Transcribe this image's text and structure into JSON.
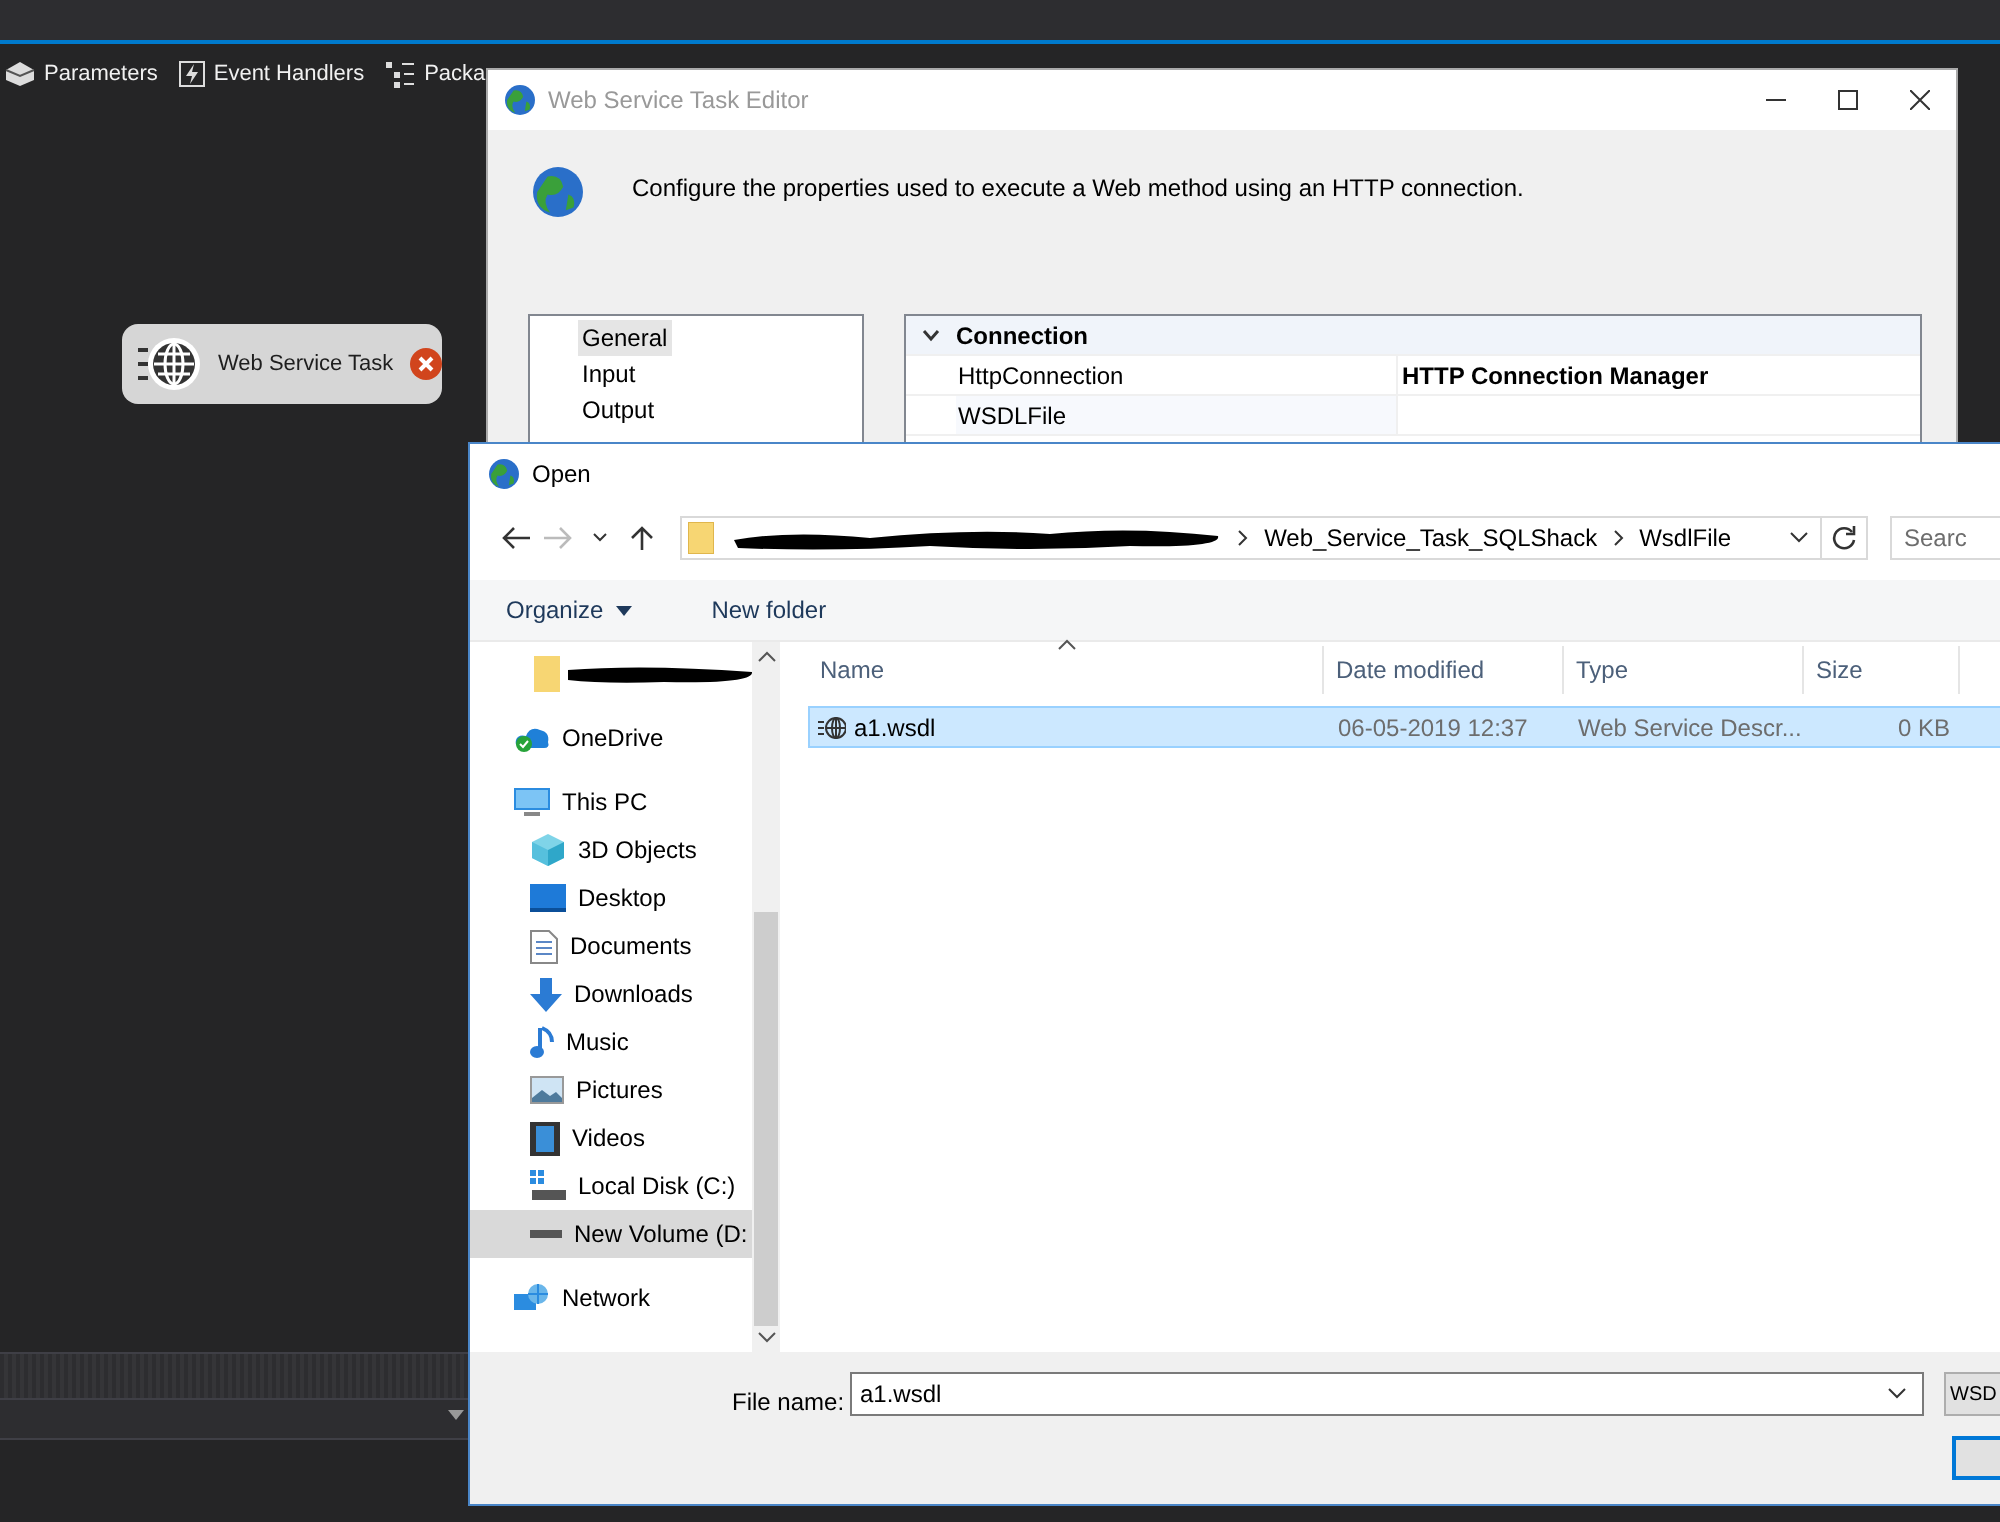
{
  "ide": {
    "toolbar_tabs": [
      {
        "label": "Parameters"
      },
      {
        "label": "Event Handlers"
      },
      {
        "label": "Packa"
      }
    ],
    "task_node": {
      "label": "Web Service Task",
      "error": true
    }
  },
  "editor": {
    "title": "Web Service Task Editor",
    "description": "Configure the properties used to execute a Web method using an HTTP connection.",
    "pages": [
      {
        "label": "General",
        "selected": true
      },
      {
        "label": "Input",
        "selected": false
      },
      {
        "label": "Output",
        "selected": false
      }
    ],
    "properties": [
      {
        "kind": "category",
        "label": "Connection",
        "expanded": true
      },
      {
        "kind": "property",
        "name": "HttpConnection",
        "value": "HTTP Connection Manager"
      },
      {
        "kind": "property",
        "name": "WSDLFile"
      }
    ]
  },
  "open_dialog": {
    "title": "Open",
    "breadcrumb": [
      "Web_Service_Task_SQLShack",
      "WsdlFile"
    ],
    "search": {
      "placeholder": "Searc"
    },
    "toolbar": {
      "organize": "Organize",
      "new_folder": "New folder"
    },
    "nav": [
      {
        "label": "OneDrive",
        "selected": false
      },
      {
        "label": "This PC",
        "selected": false,
        "children": [
          {
            "label": "3D Objects",
            "selected": false
          },
          {
            "label": "Desktop",
            "selected": false
          },
          {
            "label": "Documents",
            "selected": false
          },
          {
            "label": "Downloads",
            "selected": false
          },
          {
            "label": "Music",
            "selected": false
          },
          {
            "label": "Pictures",
            "selected": false
          },
          {
            "label": "Videos",
            "selected": false
          },
          {
            "label": "Local Disk (C:)",
            "selected": false
          },
          {
            "label": "New Volume (D:",
            "selected": true
          }
        ]
      },
      {
        "label": "Network",
        "selected": false
      }
    ],
    "columns": [
      {
        "label": "Name",
        "sorted": true
      },
      {
        "label": "Date modified",
        "sorted": false
      },
      {
        "label": "Type",
        "sorted": false
      },
      {
        "label": "Size",
        "sorted": false
      }
    ],
    "files": [
      {
        "name": "a1.wsdl",
        "date": "06-05-2019 12:37",
        "type": "Web Service Descr...",
        "size": "0 KB",
        "selected": true
      }
    ],
    "file_name": {
      "label": "File name:",
      "value": "a1.wsdl"
    },
    "filter": {
      "value": "WSD"
    }
  }
}
